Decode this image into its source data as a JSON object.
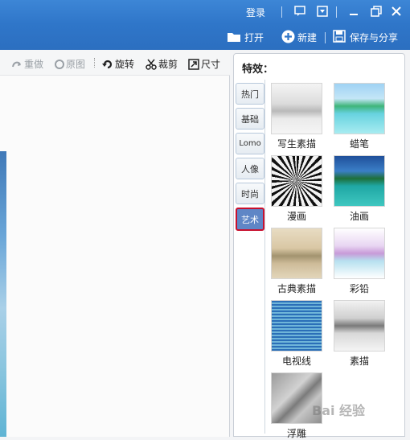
{
  "titlebar": {
    "login_label": "登录",
    "open_label": "打开",
    "new_label": "新建",
    "save_share_label": "保存与分享"
  },
  "edit_toolbar": {
    "redo_label": "重做",
    "original_label": "原图",
    "rotate_label": "旋转",
    "crop_label": "裁剪",
    "size_label": "尺寸"
  },
  "panel": {
    "title": "特效：",
    "tabs": [
      "热门",
      "基础",
      "Lomo",
      "人像",
      "时尚",
      "艺术"
    ],
    "active_tab": "艺术",
    "effects": [
      "写生素描",
      "蜡笔",
      "漫画",
      "油画",
      "古典素描",
      "彩铅",
      "电视线",
      "素描",
      "浮雕"
    ]
  },
  "watermark": "Bai 经验"
}
